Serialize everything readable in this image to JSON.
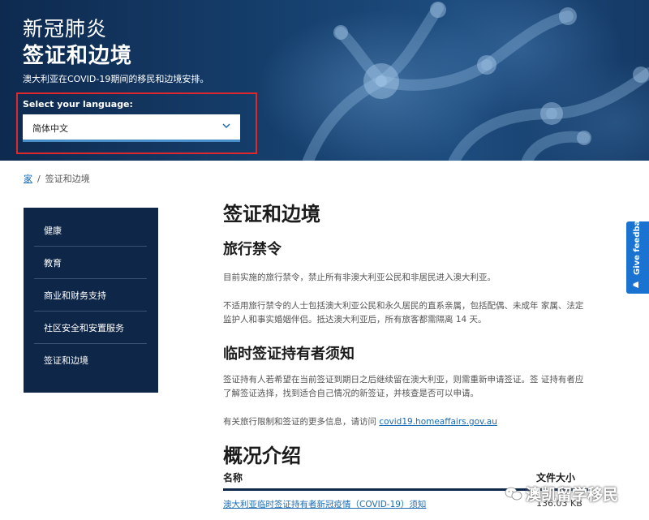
{
  "hero": {
    "title_line1": "新冠肺炎",
    "title_line2": "签证和边境",
    "subtitle": "澳大利亚在COVID-19期间的移民和边境安排。",
    "language_label": "Select your language:",
    "language_selected": "简体中文"
  },
  "breadcrumb": {
    "home": "家",
    "separator": "/",
    "current": "签证和边境"
  },
  "sidebar": {
    "items": [
      {
        "label": "健康"
      },
      {
        "label": "教育"
      },
      {
        "label": "商业和财务支持"
      },
      {
        "label": "社区安全和安置服务"
      },
      {
        "label": "签证和边境"
      }
    ]
  },
  "main": {
    "title": "签证和边境",
    "travel_ban_heading": "旅行禁令",
    "travel_ban_p1": "目前实施的旅行禁令，禁止所有非澳大利亚公民和非居民进入澳大利亚。",
    "travel_ban_p2": "不适用旅行禁令的人士包括澳大利亚公民和永久居民的直系亲属，包括配偶、未成年 家属、法定监护人和事实婚姻伴侣。抵达澳大利亚后，所有旅客都需隔离 14 天。",
    "temp_visa_heading": "临时签证持有者须知",
    "temp_visa_p": "签证持有人若希望在当前签证到期日之后继续留在澳大利亚，则需重新申请签证。签 证持有者应了解签证选择，找到适合自己情况的新签证，并核查是否可以申请。",
    "more_info_prefix": "有关旅行限制和签证的更多信息，请访问 ",
    "more_info_link": "covid19.homeaffairs.gov.au",
    "overview_heading": "概况介绍",
    "table": {
      "col_name": "名称",
      "col_size": "文件大小",
      "rows": [
        {
          "name": "澳大利亚临时签证持有者新冠疫情（COVID-19）须知",
          "size": "136.03 KB"
        }
      ]
    }
  },
  "watermark": "澳凯留学移民",
  "feedback": {
    "label": "Give feedback"
  },
  "colors": {
    "navy": "#0e2647",
    "link": "#1a6bb3",
    "feedback": "#1a73d1",
    "highlight_box": "#e0272c"
  }
}
